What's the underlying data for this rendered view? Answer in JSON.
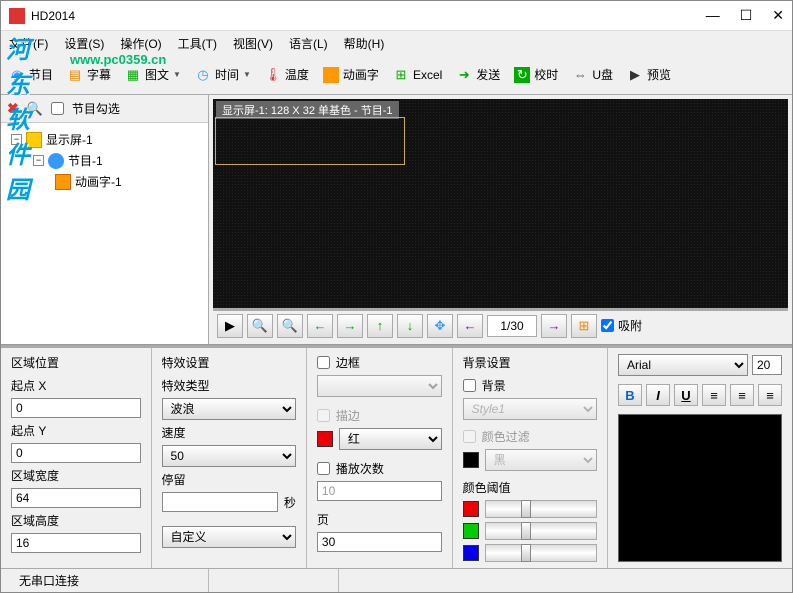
{
  "window": {
    "title": "HD2014"
  },
  "menu": {
    "file": "文件(F)",
    "settings": "设置(S)",
    "operate": "操作(O)",
    "tools": "工具(T)",
    "view": "视图(V)",
    "language": "语言(L)",
    "help": "帮助(H)"
  },
  "watermark": {
    "logo": "河东软件园",
    "url": "www.pc0359.cn"
  },
  "toolbar": {
    "program": "节目",
    "subtitle": "字幕",
    "picture": "图文",
    "time": "时间",
    "temp": "温度",
    "animtext": "动画字",
    "excel": "Excel",
    "send": "发送",
    "calibrate": "校时",
    "usb": "U盘",
    "preview": "预览"
  },
  "tree": {
    "check_label": "节目勾选",
    "node1": "显示屏-1",
    "node2": "节目-1",
    "node3": "动画字-1"
  },
  "led": {
    "label": "显示屏-1: 128 X 32 单基色 - 节目-1"
  },
  "nav": {
    "page": "1/30",
    "snap": "吸附"
  },
  "region": {
    "title": "区域位置",
    "x_label": "起点 X",
    "x_val": "0",
    "y_label": "起点 Y",
    "y_val": "0",
    "w_label": "区域宽度",
    "w_val": "64",
    "h_label": "区域高度",
    "h_val": "16"
  },
  "effect": {
    "title": "特效设置",
    "type_label": "特效类型",
    "type_val": "波浪",
    "speed_label": "速度",
    "speed_val": "50",
    "stay_label": "停留",
    "stay_val": "",
    "stay_unit": "秒",
    "custom_val": "自定义"
  },
  "border": {
    "border_label": "边框",
    "border_val": "",
    "stroke_label": "描边",
    "stroke_color": "红",
    "play_label": "播放次数",
    "play_val": "10",
    "page_label": "页",
    "page_val": "30"
  },
  "bg": {
    "title": "背景设置",
    "bg_label": "背景",
    "bg_val": "Style1",
    "filter_label": "颜色过滤",
    "filter_val": "黑",
    "thresh_label": "颜色阈值"
  },
  "font": {
    "name": "Arial",
    "size": "20",
    "b": "B",
    "i": "I",
    "u": "U"
  },
  "status": {
    "conn": "无串口连接"
  },
  "colors": {
    "red": "#e00000",
    "green": "#00c000",
    "blue": "#0000e0",
    "black": "#000000"
  }
}
